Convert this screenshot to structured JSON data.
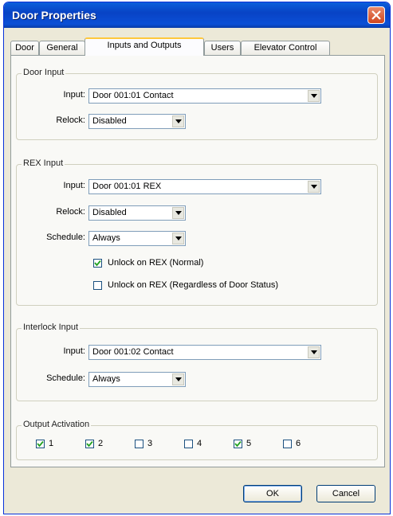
{
  "window": {
    "title": "Door Properties"
  },
  "tabs": [
    {
      "label": "Door"
    },
    {
      "label": "General"
    },
    {
      "label": "Inputs and Outputs"
    },
    {
      "label": "Users"
    },
    {
      "label": "Elevator Control"
    }
  ],
  "door_input": {
    "legend": "Door Input",
    "input_label": "Input:",
    "input_value": "Door 001:01 Contact",
    "relock_label": "Relock:",
    "relock_value": "Disabled"
  },
  "rex_input": {
    "legend": "REX Input",
    "input_label": "Input:",
    "input_value": "Door 001:01 REX",
    "relock_label": "Relock:",
    "relock_value": "Disabled",
    "schedule_label": "Schedule:",
    "schedule_value": "Always",
    "unlock_normal": {
      "label": "Unlock on REX (Normal)",
      "checked": true
    },
    "unlock_regardless": {
      "label": "Unlock on REX (Regardless of Door Status)",
      "checked": false
    }
  },
  "interlock_input": {
    "legend": "Interlock Input",
    "input_label": "Input:",
    "input_value": "Door 001:02 Contact",
    "schedule_label": "Schedule:",
    "schedule_value": "Always"
  },
  "output_activation": {
    "legend": "Output Activation",
    "outputs": [
      {
        "label": "1",
        "checked": true
      },
      {
        "label": "2",
        "checked": true
      },
      {
        "label": "3",
        "checked": false
      },
      {
        "label": "4",
        "checked": false
      },
      {
        "label": "5",
        "checked": true
      },
      {
        "label": "6",
        "checked": false
      }
    ]
  },
  "buttons": {
    "ok": "OK",
    "cancel": "Cancel"
  }
}
